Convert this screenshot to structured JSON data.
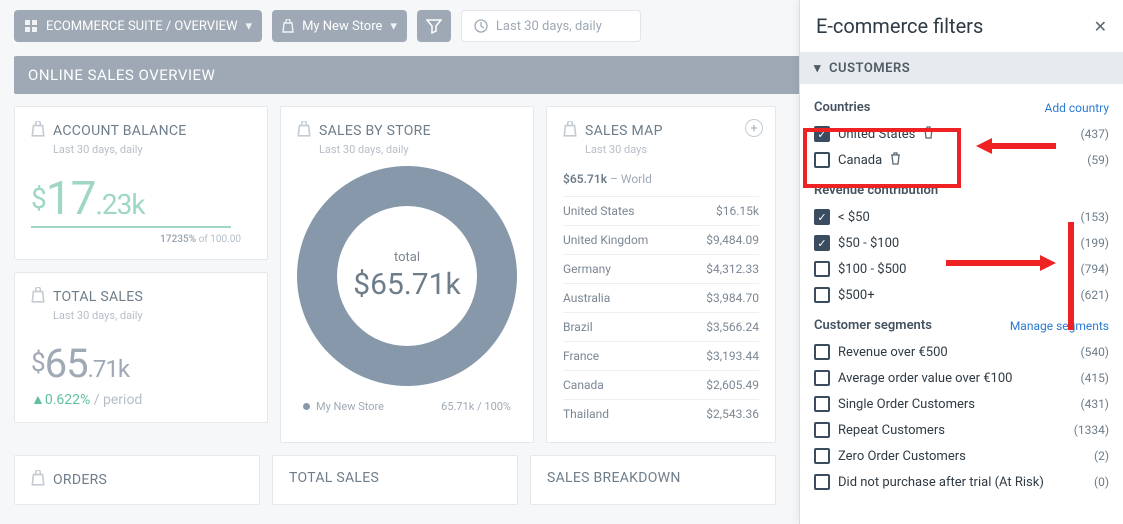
{
  "topbar": {
    "breadcrumb": "ECOMMERCE SUITE / OVERVIEW",
    "store": "My New Store",
    "date_range": "Last 30 days, daily"
  },
  "section_title": "ONLINE SALES OVERVIEW",
  "cards": {
    "account_balance": {
      "title": "ACCOUNT BALANCE",
      "sub": "Last 30 days, daily",
      "currency": "$",
      "int": "17",
      "dec": ".23k",
      "range_pct": "17235%",
      "range_of": "of 100.00"
    },
    "total_sales": {
      "title": "TOTAL SALES",
      "sub": "Last 30 days, daily",
      "currency": "$",
      "int": "65",
      "dec": ".71k",
      "delta_pct": "0.622%",
      "delta_unit": "/ period"
    },
    "sales_by_store": {
      "title": "SALES BY STORE",
      "sub": "Last 30 days, daily",
      "donut_label": "total",
      "donut_value": "$65.71k",
      "legend_store": "My New Store",
      "legend_value": "65.71k",
      "legend_pct": "100%"
    },
    "sales_map": {
      "title": "SALES MAP",
      "sub": "Last 30 days",
      "world_value": "$65.71k",
      "world_label": "– World",
      "rows": [
        {
          "country": "United States",
          "value": "$16.15k"
        },
        {
          "country": "United Kingdom",
          "value": "$9,484.09"
        },
        {
          "country": "Germany",
          "value": "$4,312.33"
        },
        {
          "country": "Australia",
          "value": "$3,984.70"
        },
        {
          "country": "Brazil",
          "value": "$3,566.24"
        },
        {
          "country": "France",
          "value": "$3,193.44"
        },
        {
          "country": "Canada",
          "value": "$2,605.49"
        },
        {
          "country": "Thailand",
          "value": "$2,543.36"
        }
      ]
    },
    "stub": {
      "orders": "ORDERS",
      "total_sales": "TOTAL SALES",
      "sales_breakdown": "SALES BREAKDOWN"
    }
  },
  "panel": {
    "title": "E-commerce filters",
    "section": "CUSTOMERS",
    "countries": {
      "label": "Countries",
      "link": "Add country",
      "items": [
        {
          "name": "United States",
          "checked": true,
          "count": "(437)"
        },
        {
          "name": "Canada",
          "checked": false,
          "count": "(59)"
        }
      ]
    },
    "revenue": {
      "label": "Revenue contribution",
      "items": [
        {
          "name": "< $50",
          "checked": true,
          "count": "(153)"
        },
        {
          "name": "$50 - $100",
          "checked": true,
          "count": "(199)"
        },
        {
          "name": "$100 - $500",
          "checked": false,
          "count": "(794)"
        },
        {
          "name": "$500+",
          "checked": false,
          "count": "(621)"
        }
      ]
    },
    "segments": {
      "label": "Customer segments",
      "link": "Manage segments",
      "items": [
        {
          "name": "Revenue over €500",
          "count": "(540)"
        },
        {
          "name": "Average order value over €100",
          "count": "(415)"
        },
        {
          "name": "Single Order Customers",
          "count": "(431)"
        },
        {
          "name": "Repeat Customers",
          "count": "(1334)"
        },
        {
          "name": "Zero Order Customers",
          "count": "(2)"
        },
        {
          "name": "Did not purchase after trial (At Risk)",
          "count": "(0)"
        }
      ]
    }
  },
  "chart_data": {
    "sales_by_store": {
      "type": "pie",
      "title": "SALES BY STORE",
      "total_label": "total",
      "total_value": 65.71,
      "unit": "k USD",
      "series": [
        {
          "name": "My New Store",
          "value": 65.71,
          "percent": 100
        }
      ]
    },
    "sales_map": {
      "type": "table",
      "title": "SALES MAP",
      "total": {
        "label": "World",
        "value": 65710
      },
      "rows": [
        {
          "country": "United States",
          "value": 16150
        },
        {
          "country": "United Kingdom",
          "value": 9484.09
        },
        {
          "country": "Germany",
          "value": 4312.33
        },
        {
          "country": "Australia",
          "value": 3984.7
        },
        {
          "country": "Brazil",
          "value": 3566.24
        },
        {
          "country": "France",
          "value": 3193.44
        },
        {
          "country": "Canada",
          "value": 2605.49
        },
        {
          "country": "Thailand",
          "value": 2543.36
        }
      ]
    }
  }
}
